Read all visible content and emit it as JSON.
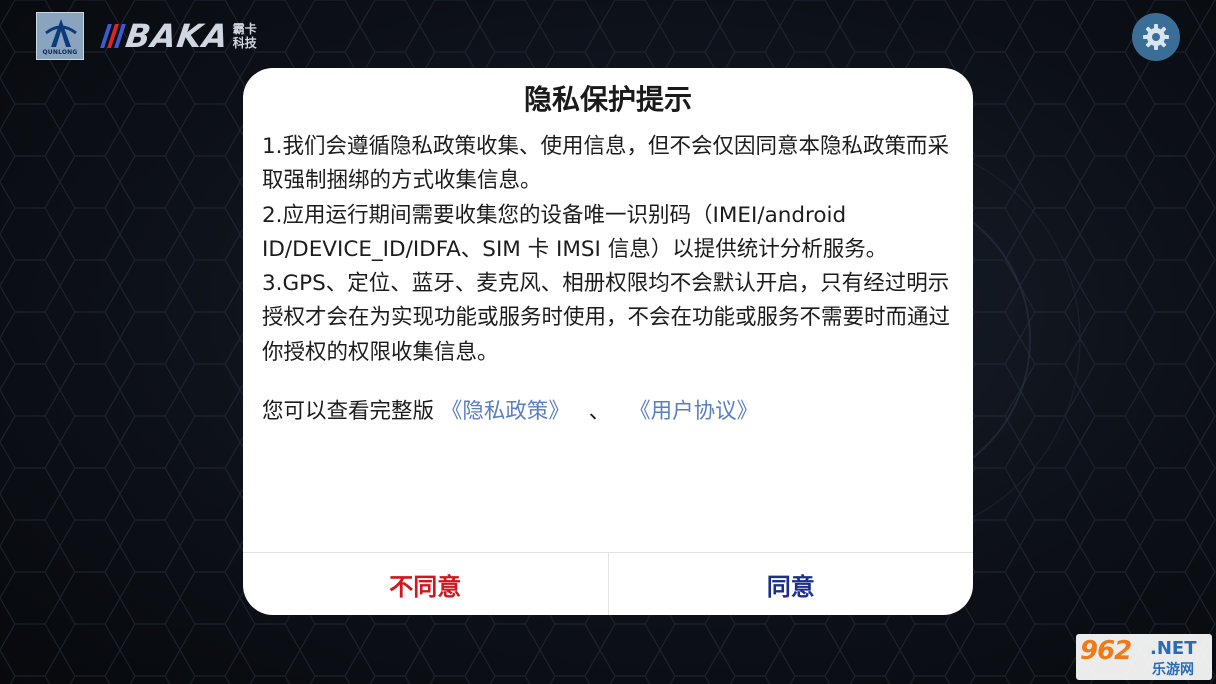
{
  "header": {
    "logo_caption": "QUNLONG",
    "brand_name": "BAKA",
    "brand_cn_top": "霸卡",
    "brand_cn_bottom": "科技",
    "settings_icon": "gear-icon"
  },
  "dialog": {
    "title": "隐私保护提示",
    "paragraphs": [
      "1.我们会遵循隐私政策收集、使用信息，但不会仅因同意本隐私政策而采取强制捆绑的方式收集信息。",
      "2.应用运行期间需要收集您的设备唯一识别码（IMEI/android ID/DEVICE_ID/IDFA、SIM 卡 IMSI 信息）以提供统计分析服务。",
      "3.GPS、定位、蓝牙、麦克风、相册权限均不会默认开启，只有经过明示授权才会在为实现功能或服务时使用，不会在功能或服务不需要时而通过你授权的权限收集信息。"
    ],
    "links_prefix": "您可以查看完整版",
    "privacy_link": "《隐私政策》",
    "separator": "、",
    "agreement_link": "《用户协议》",
    "disagree_label": "不同意",
    "agree_label": "同意"
  },
  "watermark": {
    "number": "962",
    "domain": ".NET",
    "cn": "乐游网"
  },
  "colors": {
    "disagree": "#d0161e",
    "agree": "#1c2f8c",
    "link": "#5a7ec2",
    "gear_bg": "#3a6e96"
  }
}
